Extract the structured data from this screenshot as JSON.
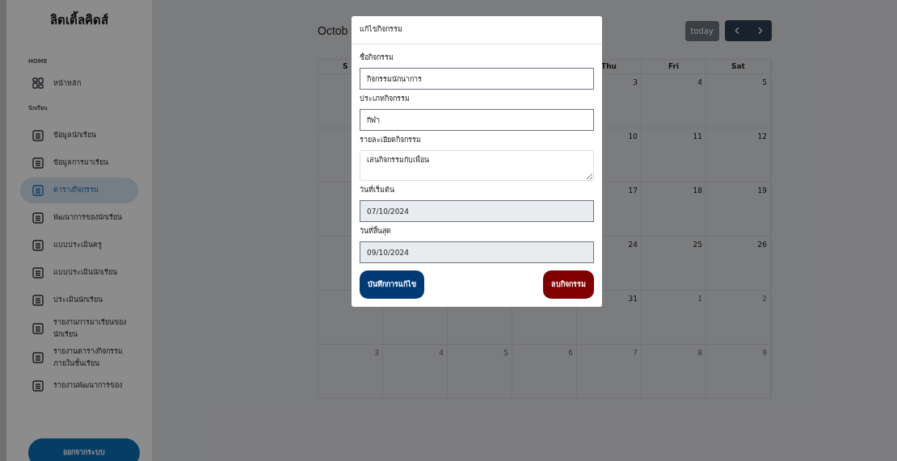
{
  "sidebar": {
    "brand": "ลิตเติ้ลคิดส์",
    "sections": [
      {
        "title": "HOME",
        "items": [
          {
            "label": "หน้าหลัก",
            "kind": "home",
            "selected": false
          }
        ]
      },
      {
        "title": "นักเรียน",
        "items": [
          {
            "label": "ข้อมูลนักเรียน",
            "kind": "page",
            "selected": false
          },
          {
            "label": "ข้อมูลการมาเรียน",
            "kind": "page",
            "selected": false
          },
          {
            "label": "ตารางกิจกรรม",
            "kind": "page",
            "selected": true
          },
          {
            "label": "พัฒนาการของนักเรียน",
            "kind": "page",
            "selected": false
          },
          {
            "label": "แบบประเมินครู",
            "kind": "page",
            "selected": false
          },
          {
            "label": "แบบประเมินนักเรียน",
            "kind": "page",
            "selected": false
          },
          {
            "label": "ประเมินนักเรียน",
            "kind": "page",
            "selected": false
          },
          {
            "label": "รายงานการมาเรียนของนักเรียน",
            "kind": "page",
            "selected": false
          },
          {
            "label": "รายงานตารางกิจกรรมภายในชั้นเรียน",
            "kind": "page",
            "selected": false
          },
          {
            "label": "รายงานพัฒนาการของ",
            "kind": "page",
            "selected": false
          }
        ]
      }
    ],
    "logout": "ออกจากระบบ"
  },
  "calendar": {
    "title": "Octob",
    "today": "today",
    "first_weekday": "S",
    "weekdays": [
      "Thu",
      "Fri",
      "Sat"
    ],
    "weeks": [
      [
        {
          "day": "3",
          "other_month": false
        },
        {
          "day": "4",
          "other_month": false
        },
        {
          "day": "5",
          "other_month": false
        }
      ],
      [
        {
          "day": "10",
          "other_month": false
        },
        {
          "day": "11",
          "other_month": false
        },
        {
          "day": "12",
          "other_month": false
        }
      ],
      [
        {
          "day": "17",
          "other_month": false
        },
        {
          "day": "18",
          "other_month": false
        },
        {
          "day": "19",
          "other_month": false
        }
      ],
      [
        {
          "day": "24",
          "other_month": false
        },
        {
          "day": "25",
          "other_month": false
        },
        {
          "day": "26",
          "other_month": false
        }
      ],
      [
        {
          "day": "31",
          "other_month": false
        },
        {
          "day": "1",
          "other_month": true
        },
        {
          "day": "2",
          "other_month": true
        }
      ],
      [
        {
          "day": "3",
          "other_month": true
        },
        {
          "day": "4",
          "other_month": true
        },
        {
          "day": "5",
          "other_month": true
        },
        {
          "day": "6",
          "other_month": true
        },
        {
          "day": "7",
          "other_month": true
        },
        {
          "day": "8",
          "other_month": true
        },
        {
          "day": "9",
          "other_month": true
        }
      ]
    ]
  },
  "modal": {
    "title": "แก้ไขกิจกรรม",
    "fields": [
      {
        "label": "ชื่อกิจกรรม",
        "value": "กิจกรรมนักนาการ",
        "kind": "text"
      },
      {
        "label": "ประเภทกิจกรรม",
        "value": "กีฬา",
        "kind": "text"
      },
      {
        "label": "รายละเอียดกิจกรรม",
        "value": "เล่นกิจกรรมกับเพื่อน",
        "kind": "textarea"
      },
      {
        "label": "วันที่เริ่มต้น",
        "value": "07/10/2024",
        "kind": "readonly"
      },
      {
        "label": "วันที่สิ้นสุด",
        "value": "09/10/2024",
        "kind": "readonly"
      }
    ],
    "save": "บันทึกการแก้ไข",
    "delete": "ลบกิจกรรม"
  }
}
